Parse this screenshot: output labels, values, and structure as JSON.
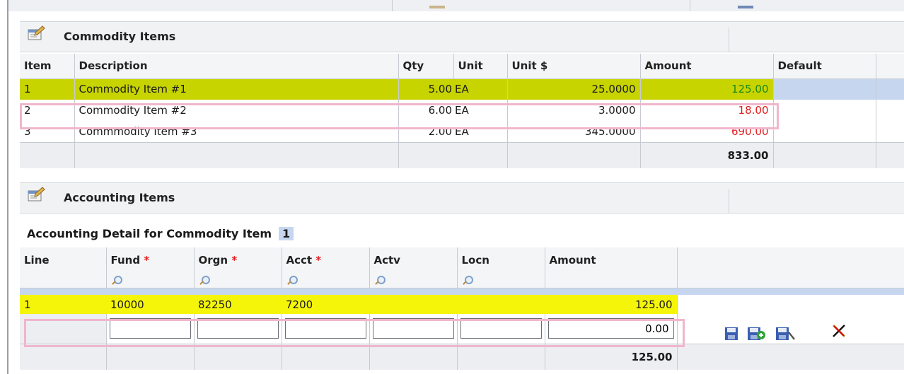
{
  "commodity_section": {
    "title": "Commodity Items",
    "headers": [
      "Item",
      "Description",
      "Qty",
      "Unit",
      "Unit $",
      "Amount",
      "Default"
    ],
    "rows": [
      {
        "item": "1",
        "description": "Commodity Item #1",
        "qty": "5.00",
        "unit": "EA",
        "unit_price": "25.0000",
        "amount": "125.00",
        "default": ""
      },
      {
        "item": "2",
        "description": "Commodity Item #2",
        "qty": "6.00",
        "unit": "EA",
        "unit_price": "3.0000",
        "amount": "18.00",
        "default": ""
      },
      {
        "item": "3",
        "description": "Commmodity Item #3",
        "qty": "2.00",
        "unit": "EA",
        "unit_price": "345.0000",
        "amount": "690.00",
        "default": ""
      }
    ],
    "total": "833.00"
  },
  "accounting_section": {
    "title": "Accounting Items",
    "detail_label": "Accounting Detail for Commodity Item",
    "detail_item": "1",
    "headers": [
      "Line",
      "Fund",
      "Orgn",
      "Acct",
      "Actv",
      "Locn",
      "Amount"
    ],
    "required_marker": "*",
    "rows": [
      {
        "line": "1",
        "fund": "10000",
        "orgn": "82250",
        "acct": "7200",
        "actv": "",
        "locn": "",
        "amount": "125.00"
      }
    ],
    "new_row": {
      "fund": "",
      "orgn": "",
      "acct": "",
      "actv": "",
      "locn": "",
      "amount": "0.00"
    },
    "total": "125.00"
  },
  "icons": {
    "section": "properties-icon",
    "lookup": "magnifier-icon",
    "save": "save-icon",
    "save_add": "save-add-icon",
    "save_edit": "save-edit-icon",
    "delete": "delete-icon"
  },
  "colors": {
    "row_highlight_green": "#c7d400",
    "row_highlight_yellow": "#f5f50a",
    "selected_blue": "#c6d6ee",
    "amount_green": "#1b8a1b",
    "amount_red": "#e21b1b",
    "annotation_pink": "#f0b6cc"
  }
}
